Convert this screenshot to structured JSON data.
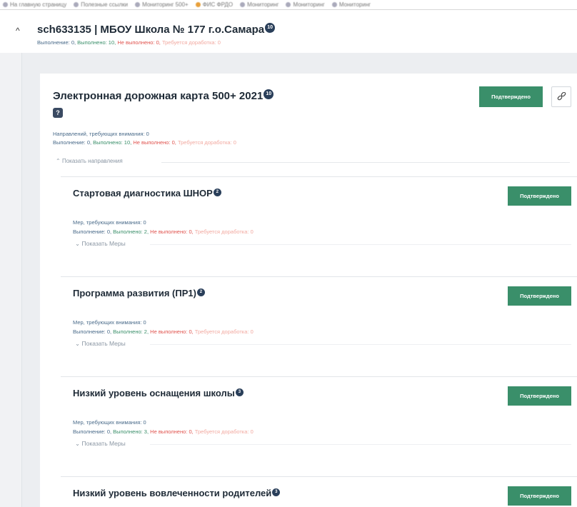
{
  "bookmarks": [
    {
      "label": "На главную страницу",
      "icon": "grid-icon"
    },
    {
      "label": "Полезные ссылки",
      "icon": "folder-icon"
    },
    {
      "label": "Мониторинг 500+",
      "icon": "globe-icon"
    },
    {
      "label": "ФИС ФРДО",
      "icon": "orange-icon"
    },
    {
      "label": "Мониторинг",
      "icon": "globe-icon"
    },
    {
      "label": "Мониторинг",
      "icon": "globe-icon"
    },
    {
      "label": "Мониторинг",
      "icon": "globe-icon"
    }
  ],
  "school": {
    "title": "sch633135 | МБОУ Школа № 177 г.о.Самара",
    "badge": "10",
    "stats": {
      "done0": "Выполнение: 0,",
      "done": "Выполнено: 10,",
      "notdone": "Не выполнено: 0,",
      "rework": "Требуется доработка: 0"
    }
  },
  "card": {
    "title": "Электронная дорожная карта 500+ 2021",
    "badge": "10",
    "help_glyph": "?",
    "attention": "Направлений, требующих внимания: 0",
    "stats": {
      "done0": "Выполнение: 0,",
      "done": "Выполнено: 10,",
      "notdone": "Не выполнено: 0,",
      "rework": "Требуется доработка: 0"
    },
    "confirm_label": "Подтверждено",
    "show_directions": "Показать направления"
  },
  "directions": [
    {
      "title": "Стартовая диагностика ШНОР",
      "badge": "2",
      "attention": "Мер, требующих внимания: 0",
      "stats": {
        "done0": "Выполнение: 0,",
        "done": "Выполнено: 2,",
        "notdone": "Не выполнено: 0,",
        "rework": "Требуется доработка: 0"
      },
      "confirm_label": "Подтверждено",
      "show_measures": "Показать Меры"
    },
    {
      "title": "Программа развития (ПР1)",
      "badge": "2",
      "attention": "Мер, требующих внимания: 0",
      "stats": {
        "done0": "Выполнение: 0,",
        "done": "Выполнено: 2,",
        "notdone": "Не выполнено: 0,",
        "rework": "Требуется доработка: 0"
      },
      "confirm_label": "Подтверждено",
      "show_measures": "Показать Меры"
    },
    {
      "title": "Низкий уровень оснащения школы",
      "badge": "3",
      "attention": "Мер, требующих внимания: 0",
      "stats": {
        "done0": "Выполнение: 0,",
        "done": "Выполнено: 3,",
        "notdone": "Не выполнено: 0,",
        "rework": "Требуется доработка: 0"
      },
      "confirm_label": "Подтверждено",
      "show_measures": "Показать Меры"
    },
    {
      "title": "Низкий уровень вовлеченности родителей",
      "badge": "3",
      "confirm_label": "Подтверждено"
    }
  ],
  "colors": {
    "accent_green": "#3a8f6a",
    "danger": "#e0524d",
    "rework": "#f2a9a0",
    "badge": "#2a3f5a"
  }
}
